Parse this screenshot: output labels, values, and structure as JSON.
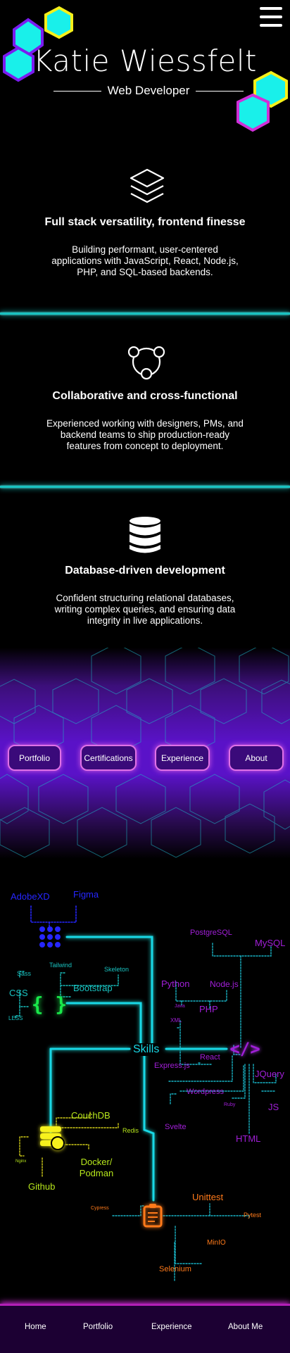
{
  "header": {
    "name": "Katie Wiessfelt",
    "role": "Web Developer"
  },
  "features": [
    {
      "icon": "layers-icon",
      "title": "Full stack versatility, frontend finesse",
      "text": "Building performant, user-centered applications with JavaScript, React, Node.js, PHP, and SQL-based backends."
    },
    {
      "icon": "network-icon",
      "title": "Collaborative and cross-functional",
      "text": "Experienced working with designers, PMs, and backend teams to ship production-ready features from concept to deployment."
    },
    {
      "icon": "database-icon",
      "title": "Database-driven development",
      "text": "Confident structuring relational databases, writing complex queries, and ensuring data integrity in live applications."
    }
  ],
  "nav_buttons": [
    "Portfolio",
    "Certifications",
    "Experience",
    "About"
  ],
  "skills": {
    "center": "Skills",
    "design": [
      "AdobeXD",
      "Figma"
    ],
    "css": [
      "CSS",
      "Sass",
      "LESS",
      "Tailwind",
      "Bootstrap",
      "Skeleton"
    ],
    "code": [
      "PostgreSQL",
      "MySQL",
      "Python",
      "Node.js",
      "Java",
      "PHP",
      "XML",
      "React",
      "Express.js",
      "Wordpress",
      "Ruby",
      "JQuery",
      "JS",
      "Svelte",
      "HTML"
    ],
    "devops": [
      "CouchDB",
      "Redis",
      "Nginx",
      "Docker/ Podman",
      "Github"
    ],
    "testing": [
      "Unittest",
      "Cypress",
      "Pytest",
      "MinIO",
      "Selenium"
    ]
  },
  "footer": [
    "Home",
    "Portfolio",
    "Experience",
    "About Me"
  ],
  "colors": {
    "cyan": "#19c3c1",
    "purple": "#a11fd8",
    "design_blue": "#2626ff",
    "css_green": "#19e84a",
    "devops_yellow": "#f7f21d",
    "testing_orange": "#ff7a1a",
    "footer_magenta": "#b21fb6"
  }
}
